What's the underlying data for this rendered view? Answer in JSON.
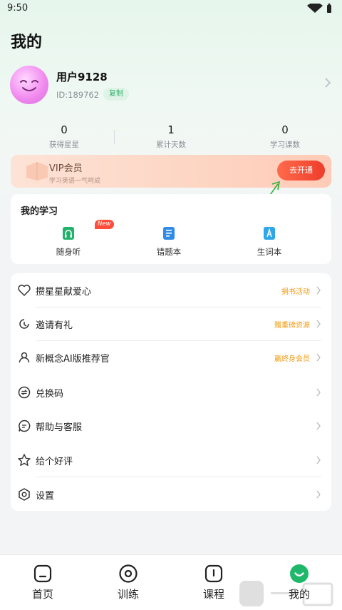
{
  "status_bar": {
    "time": "9:50"
  },
  "page": {
    "title": "我的"
  },
  "profile": {
    "username": "用户9128",
    "user_id": "ID:189762",
    "copy_label": "复制"
  },
  "stats": [
    {
      "value": "0",
      "label": "获得星星"
    },
    {
      "value": "1",
      "label": "累计天数"
    },
    {
      "value": "0",
      "label": "学习课数"
    }
  ],
  "vip": {
    "title": "VIP会员",
    "subtitle": "学习英语一气呵成",
    "button": "去开通"
  },
  "study": {
    "title": "我的学习",
    "items": [
      {
        "label": "随身听",
        "icon": "headphones-icon",
        "badge": "New"
      },
      {
        "label": "错题本",
        "icon": "mistake-book-icon"
      },
      {
        "label": "生词本",
        "icon": "vocabulary-icon"
      }
    ]
  },
  "menu": [
    {
      "label": "攒星星献爱心",
      "tag": "捐书活动",
      "icon": "heart-icon"
    },
    {
      "label": "邀请有礼",
      "tag": "赠重磅资源",
      "icon": "invite-icon"
    },
    {
      "label": "新概念AI版推荐官",
      "tag": "赢终身会员",
      "icon": "user-icon"
    },
    {
      "label": "兑换码",
      "tag": "",
      "icon": "exchange-icon"
    },
    {
      "label": "帮助与客服",
      "tag": "",
      "icon": "chat-icon"
    },
    {
      "label": "给个好评",
      "tag": "",
      "icon": "star-icon"
    },
    {
      "label": "设置",
      "tag": "",
      "icon": "settings-icon"
    }
  ],
  "tabs": [
    {
      "label": "首页",
      "icon": "home-icon"
    },
    {
      "label": "训练",
      "icon": "training-icon"
    },
    {
      "label": "课程",
      "icon": "course-icon"
    },
    {
      "label": "我的",
      "icon": "profile-smile-icon",
      "active": true
    }
  ],
  "colors": {
    "accent_green": "#2fb06a",
    "vip_button": "#ee3d2b",
    "tag_orange": "#f19a12"
  }
}
